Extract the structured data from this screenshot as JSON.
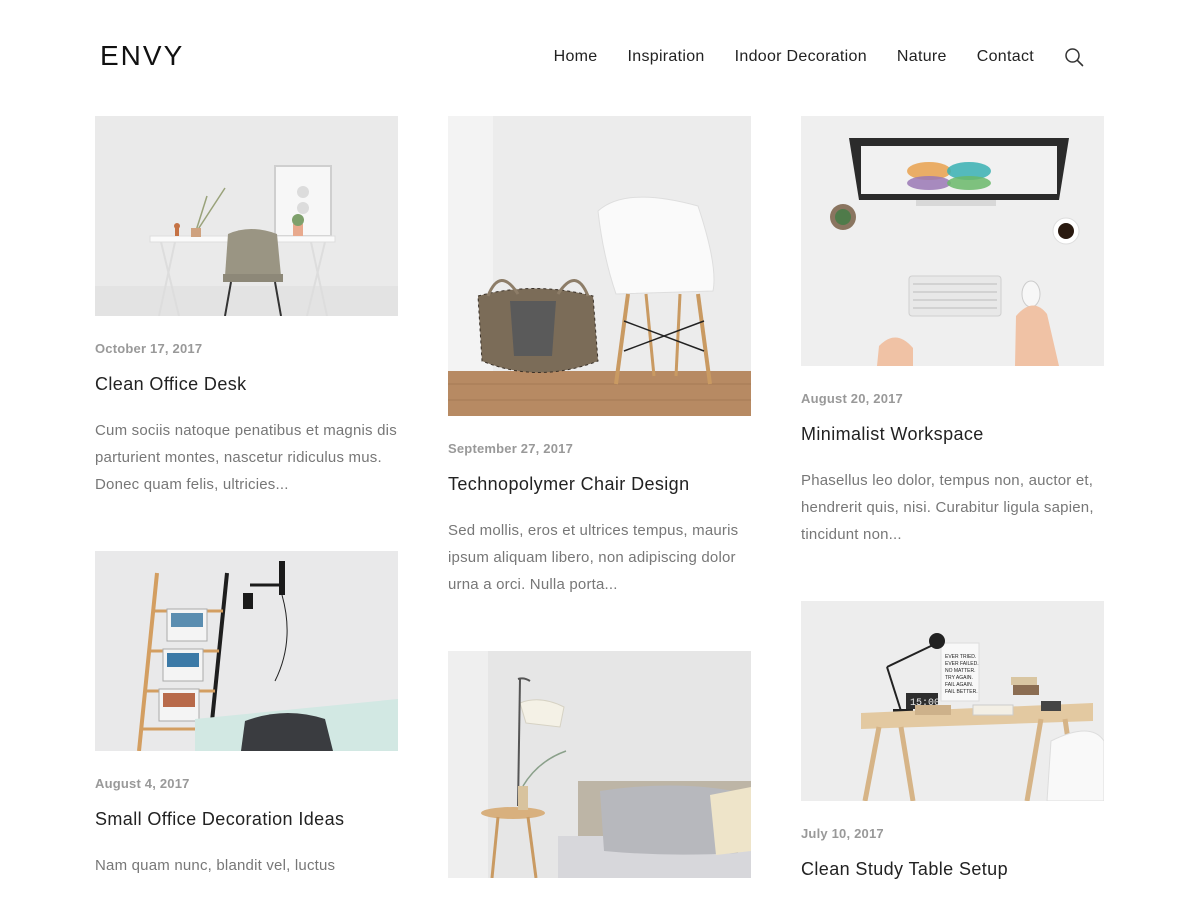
{
  "site": {
    "logo": "ENVY"
  },
  "nav": {
    "items": [
      {
        "label": "Home"
      },
      {
        "label": "Inspiration"
      },
      {
        "label": "Indoor Decoration"
      },
      {
        "label": "Nature"
      },
      {
        "label": "Contact"
      }
    ],
    "search_icon": "search-icon"
  },
  "posts": [
    {
      "date": "October 17, 2017",
      "title": "Clean Office Desk",
      "excerpt": "Cum sociis natoque penatibus et magnis dis parturient montes, nascetur ridiculus mus. Donec quam felis, ultricies..."
    },
    {
      "date": "September 27, 2017",
      "title": "Technopolymer Chair Design",
      "excerpt": "Sed mollis, eros et ultrices tempus, mauris ipsum aliquam libero, non adipiscing dolor urna a orci. Nulla porta..."
    },
    {
      "date": "August 20, 2017",
      "title": "Minimalist Workspace",
      "excerpt": "Phasellus leo dolor, tempus non, auctor et, hendrerit quis, nisi. Curabitur ligula sapien, tincidunt non..."
    },
    {
      "date": "August 4, 2017",
      "title": "Small Office Decoration Ideas",
      "excerpt": "Nam quam nunc, blandit vel, luctus"
    },
    {
      "date": "",
      "title": "",
      "excerpt": ""
    },
    {
      "date": "July 10, 2017",
      "title": "Clean Study Table Setup",
      "excerpt": ""
    }
  ],
  "poster_text": "EVER TRIED. EVER FAILED. NO MATTER. TRY AGAIN. FAIL AGAIN. FAIL BETTER.",
  "clock_text": "15:00",
  "colors": {
    "text": "#222222",
    "muted": "#777777",
    "date": "#999999"
  }
}
